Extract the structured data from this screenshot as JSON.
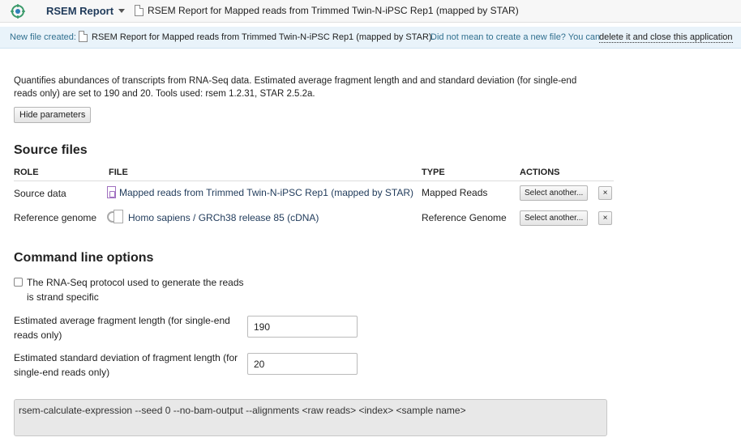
{
  "header": {
    "app_name": "RSEM Report",
    "document_title": "RSEM Report for Mapped reads from Trimmed Twin-N-iPSC Rep1 (mapped by STAR)"
  },
  "notice": {
    "prefix": "New file created:",
    "file_name": "RSEM Report for Mapped reads from Trimmed Twin-N-iPSC Rep1 (mapped by STAR).",
    "question": "Did not mean to create a new file? You can",
    "link": "delete it and close this application"
  },
  "description": "Quantifies abundances of transcripts from RNA-Seq data. Estimated average fragment length and and standard deviation (for single-end reads only) are set to 190 and 20. Tools used: rsem 1.2.31, STAR 2.5.2a.",
  "hide_parameters_label": "Hide parameters",
  "source_files": {
    "heading": "Source files",
    "columns": [
      "ROLE",
      "FILE",
      "TYPE",
      "ACTIONS"
    ],
    "rows": [
      {
        "role": "Source data",
        "file": "Mapped reads from Trimmed Twin-N-iPSC Rep1 (mapped by STAR)",
        "type": "Mapped Reads",
        "action": "Select another...",
        "remove": "×",
        "icon": "reads-file-icon"
      },
      {
        "role": "Reference genome",
        "file": "Homo sapiens / GRCh38 release 85 (cDNA)",
        "type": "Reference Genome",
        "action": "Select another...",
        "remove": "×",
        "icon": "genome-file-icon"
      }
    ]
  },
  "command_line": {
    "heading": "Command line options",
    "strand_specific_label": "The RNA-Seq protocol used to generate the reads is strand specific",
    "strand_specific_checked": false,
    "fragment_length_label": "Estimated average fragment length (for single-end reads only)",
    "fragment_length_value": "190",
    "fragment_sd_label": "Estimated standard deviation of fragment length (for single-end reads only)",
    "fragment_sd_value": "20",
    "command": "rsem-calculate-expression --seed 0 --no-bam-output --alignments  <raw reads> <index> <sample name>"
  }
}
